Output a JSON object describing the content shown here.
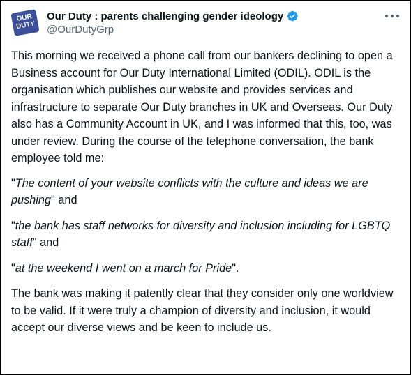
{
  "tweet": {
    "author": {
      "display_name": "Our Duty : parents challenging gender ideology",
      "handle": "@OurDutyGrp",
      "avatar_text_line1": "OUR",
      "avatar_text_line2": "DUTY",
      "verified_icon": "verified-badge-icon",
      "verified_color": "#1d9bf0"
    },
    "more_icon": "more-options-icon",
    "paragraphs": {
      "p1": "This morning we received a phone call from our bankers declining to open a Business account for Our Duty International Limited (ODIL). ODIL is the organisation which publishes our website and provides services and infrastructure to separate Our Duty branches in UK and Overseas. Our Duty also has a Community Account in UK, and I was informed that this, too, was under review. During the course of the telephone conversation, the bank employee told me:",
      "q1_open": "\"",
      "q1_text": "The content of your website conflicts with the culture and ideas we are pushing",
      "q1_close": "\" and",
      "q2_open": "\"",
      "q2_text": "the bank has staff networks for diversity and inclusion including for LGBTQ staff",
      "q2_close": "\" and",
      "q3_open": "\"",
      "q3_text": "at the weekend I went on a march for Pride",
      "q3_close": "\".",
      "p_last": "The bank was making it patently clear that they consider only one worldview to be valid. If it were truly a champion of diversity and inclusion, it would accept our diverse views and be keen to include us."
    }
  }
}
